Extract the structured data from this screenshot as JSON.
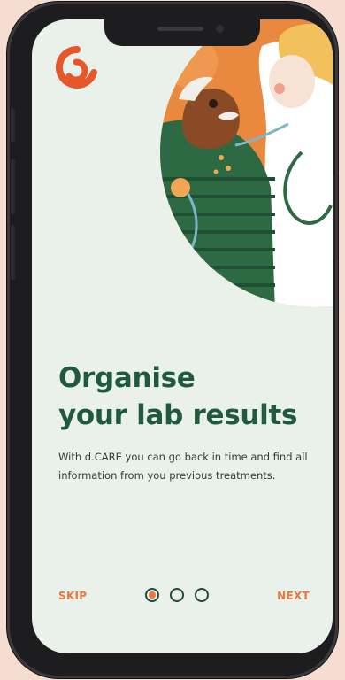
{
  "onboarding": {
    "title_line1": "Organise",
    "title_line2": "your lab results",
    "description": "With d.CARE you can go back in time and find all information from you previous treatments.",
    "skip_label": "SKIP",
    "next_label": "NEXT",
    "pager": {
      "total": 3,
      "active": 1
    }
  },
  "colors": {
    "accent": "#e57a3e",
    "title": "#1f5a3c",
    "screen_bg": "#e9f1ea",
    "page_bg": "#f6ddd2"
  }
}
